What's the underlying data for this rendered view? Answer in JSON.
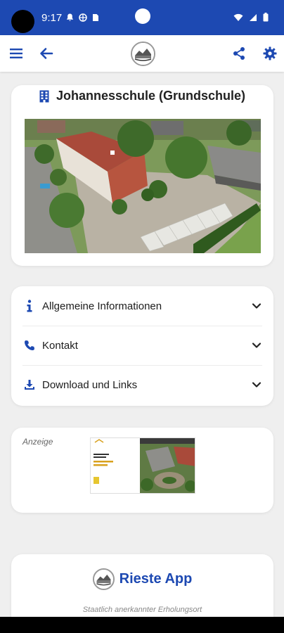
{
  "status_bar": {
    "time": "9:17",
    "bg_color": "#1d49b2",
    "left_icons": [
      "notification-bell-icon",
      "vpn-globe-icon",
      "sim-card-icon"
    ],
    "right_icons": [
      "wifi-icon",
      "signal-icon",
      "battery-icon"
    ]
  },
  "app_bar": {
    "left_icons": [
      "menu-icon",
      "back-arrow-icon"
    ],
    "center_logo": "rieste-logo",
    "right_icons": [
      "share-icon",
      "settings-gear-icon"
    ],
    "accent_color": "#1d49b2"
  },
  "school": {
    "icon": "school-building-icon",
    "title": "Johannesschule (Grundschule)"
  },
  "accordion": [
    {
      "icon": "info-icon",
      "label": "Allgemeine Informationen"
    },
    {
      "icon": "phone-icon",
      "label": "Kontakt"
    },
    {
      "icon": "download-icon",
      "label": "Download und Links"
    }
  ],
  "ad": {
    "label": "Anzeige"
  },
  "footer": {
    "app_name": "Rieste App",
    "subtitle": "Staatlich anerkannter Erholungsort"
  }
}
